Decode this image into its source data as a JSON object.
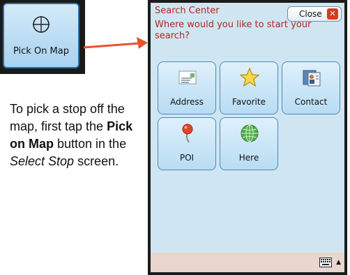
{
  "pick_button": {
    "label": "Pick On Map",
    "icon": "crosshair-icon"
  },
  "instructions": {
    "part1": "To pick a stop off the map, first tap the ",
    "bold": "Pick on Map",
    "part2": " button in the ",
    "italic": "Select Stop",
    "part3": " screen."
  },
  "search_center": {
    "title": "Search Center",
    "prompt": "Where would you like to start your search?",
    "close_label": "Close",
    "close_icon": "close-icon",
    "tiles": [
      {
        "label": "Address",
        "icon": "address-card-icon"
      },
      {
        "label": "Favorite",
        "icon": "star-icon"
      },
      {
        "label": "Contact",
        "icon": "contact-card-icon"
      },
      {
        "label": "POI",
        "icon": "pushpin-icon"
      },
      {
        "label": "Here",
        "icon": "globe-icon"
      }
    ],
    "keyboard_icon": "keyboard-icon"
  },
  "colors": {
    "arrow": "#e8532b",
    "title_text": "#b3261e",
    "panel_bg": "#cfe6f2",
    "tile_border": "#4f87b8"
  }
}
